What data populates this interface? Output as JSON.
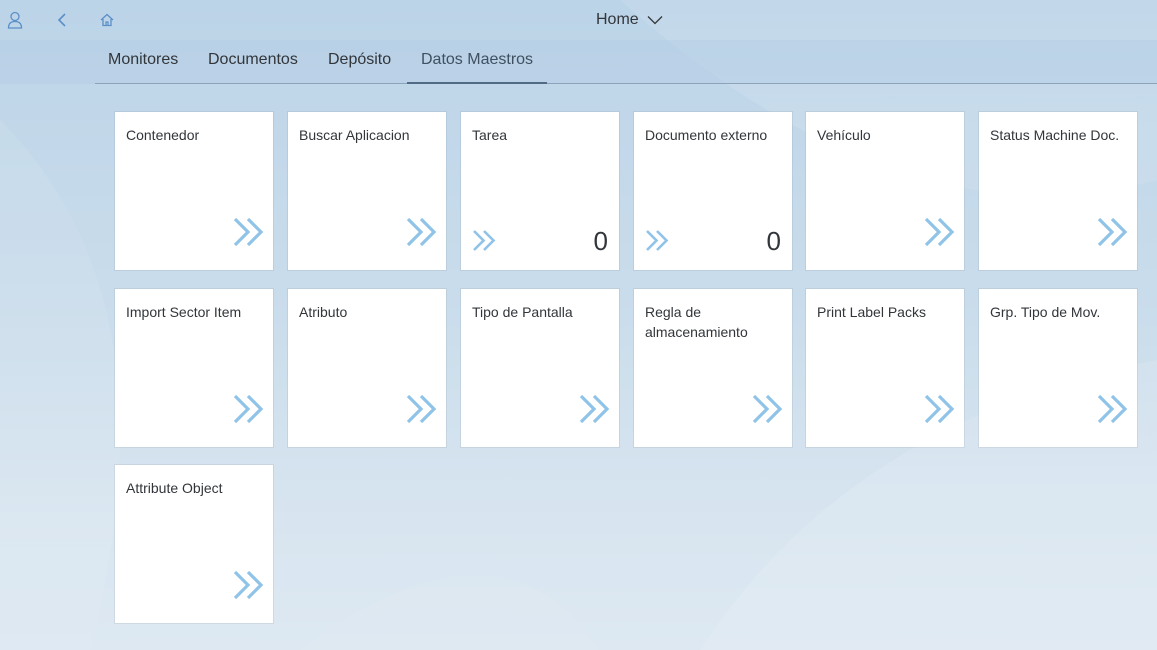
{
  "header": {
    "title": "Home",
    "icons": {
      "user": "user-icon",
      "back": "back-icon",
      "home": "home-icon",
      "menu": "chevron-down-icon"
    }
  },
  "anchor_bar": {
    "tabs": [
      {
        "label": "Monitores"
      },
      {
        "label": "Documentos"
      },
      {
        "label": "Depósito"
      },
      {
        "label": "Datos Maestros",
        "selected": true
      }
    ]
  },
  "tiles": [
    {
      "title": "Contenedor",
      "icon": "double-chevron-right-icon"
    },
    {
      "title": "Buscar Aplicacion",
      "icon": "double-chevron-right-icon"
    },
    {
      "title": "Tarea",
      "icon": "double-chevron-right-icon",
      "number": "0"
    },
    {
      "title": "Documento externo",
      "icon": "double-chevron-right-icon",
      "number": "0"
    },
    {
      "title": "Vehículo",
      "icon": "double-chevron-right-icon"
    },
    {
      "title": "Status Machine Doc.",
      "icon": "double-chevron-right-icon"
    },
    {
      "title": "Import Sector Item",
      "icon": "double-chevron-right-icon"
    },
    {
      "title": "Atributo",
      "icon": "double-chevron-right-icon"
    },
    {
      "title": "Tipo de Pantalla",
      "icon": "double-chevron-right-icon"
    },
    {
      "title": "Regla de almacenamiento",
      "icon": "double-chevron-right-icon"
    },
    {
      "title": "Print Label Packs",
      "icon": "double-chevron-right-icon"
    },
    {
      "title": "Grp. Tipo de Mov.",
      "icon": "double-chevron-right-icon"
    },
    {
      "title": "Attribute Object",
      "icon": "double-chevron-right-icon"
    }
  ],
  "colors": {
    "accent": "#5b8fc7",
    "icon": "#8fc3e8",
    "text": "#32363a"
  }
}
